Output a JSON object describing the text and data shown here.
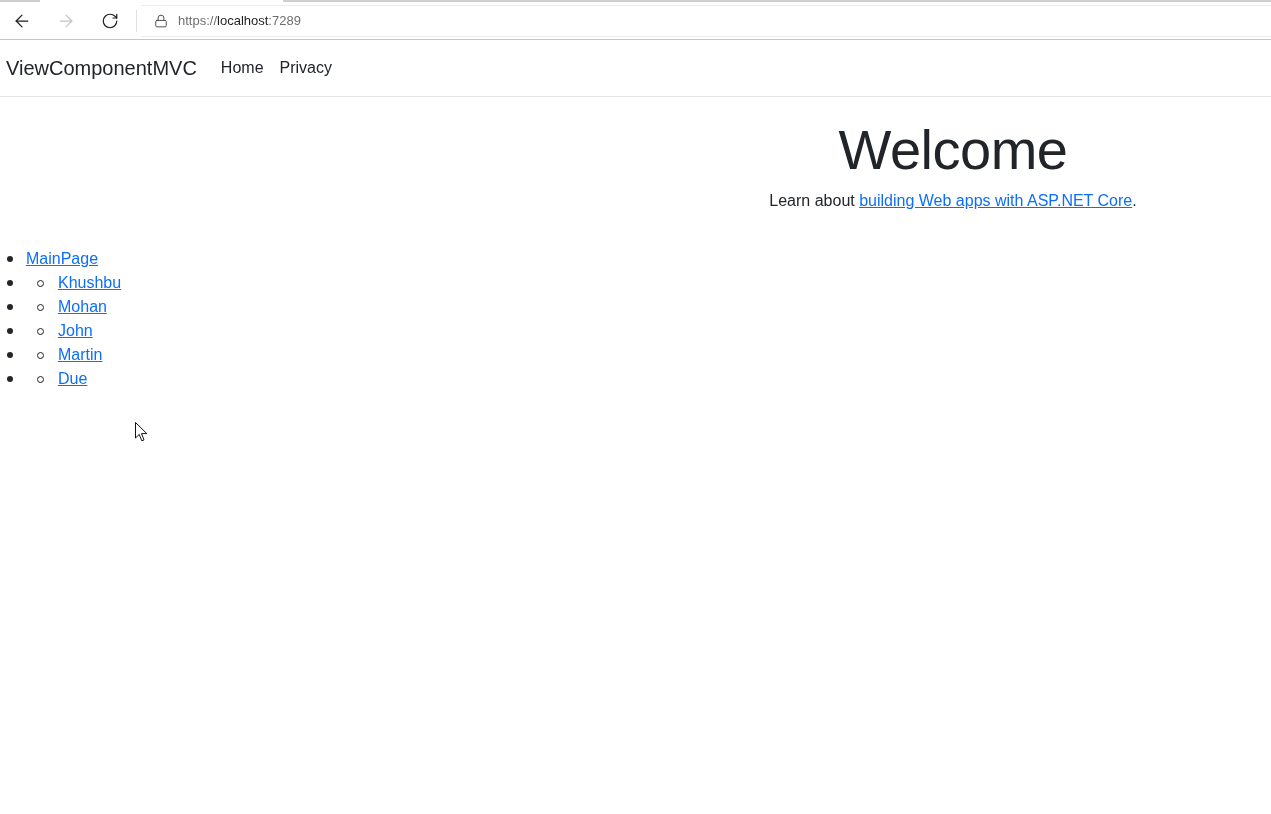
{
  "browser": {
    "back": {
      "disabled": false
    },
    "forward": {
      "disabled": true
    },
    "url": {
      "scheme": "https://",
      "host": "localhost",
      "port": ":7289"
    }
  },
  "navbar": {
    "brand": "ViewComponentMVC",
    "links": [
      {
        "label": "Home"
      },
      {
        "label": "Privacy"
      }
    ]
  },
  "hero": {
    "title": "Welcome",
    "intro": "Learn about",
    "link": "building Web apps with ASP.NET Core",
    "end": "."
  },
  "menu": {
    "label": "MainPage",
    "children": [
      {
        "label": "Khushbu"
      },
      {
        "label": "Mohan"
      },
      {
        "label": "John"
      },
      {
        "label": "Martin"
      },
      {
        "label": "Due"
      }
    ]
  }
}
